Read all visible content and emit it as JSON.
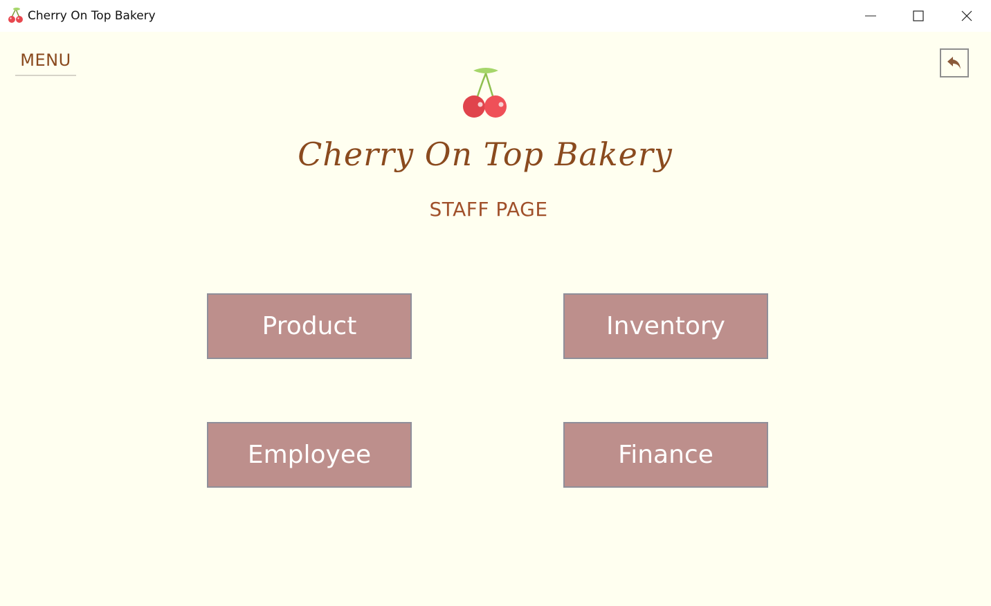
{
  "window": {
    "title": "Cherry On Top Bakery",
    "controls": {
      "minimize": "minimize-icon",
      "maximize": "maximize-icon",
      "close": "close-icon"
    }
  },
  "header": {
    "menu_label": "MENU",
    "back_icon": "undo-arrow-icon",
    "logo_icon": "cherry-icon"
  },
  "main": {
    "brand_title": "Cherry On Top Bakery",
    "subtitle": "STAFF PAGE",
    "buttons": [
      {
        "label": "Product"
      },
      {
        "label": "Inventory"
      },
      {
        "label": "Employee"
      },
      {
        "label": "Finance"
      }
    ]
  },
  "colors": {
    "background": "#fffff0",
    "brand_brown": "#8a4a1e",
    "button_fill": "#bd8f8c",
    "button_border": "#8f8f9a",
    "cherry_red": "#e8474f",
    "leaf_green": "#a6d66a"
  }
}
